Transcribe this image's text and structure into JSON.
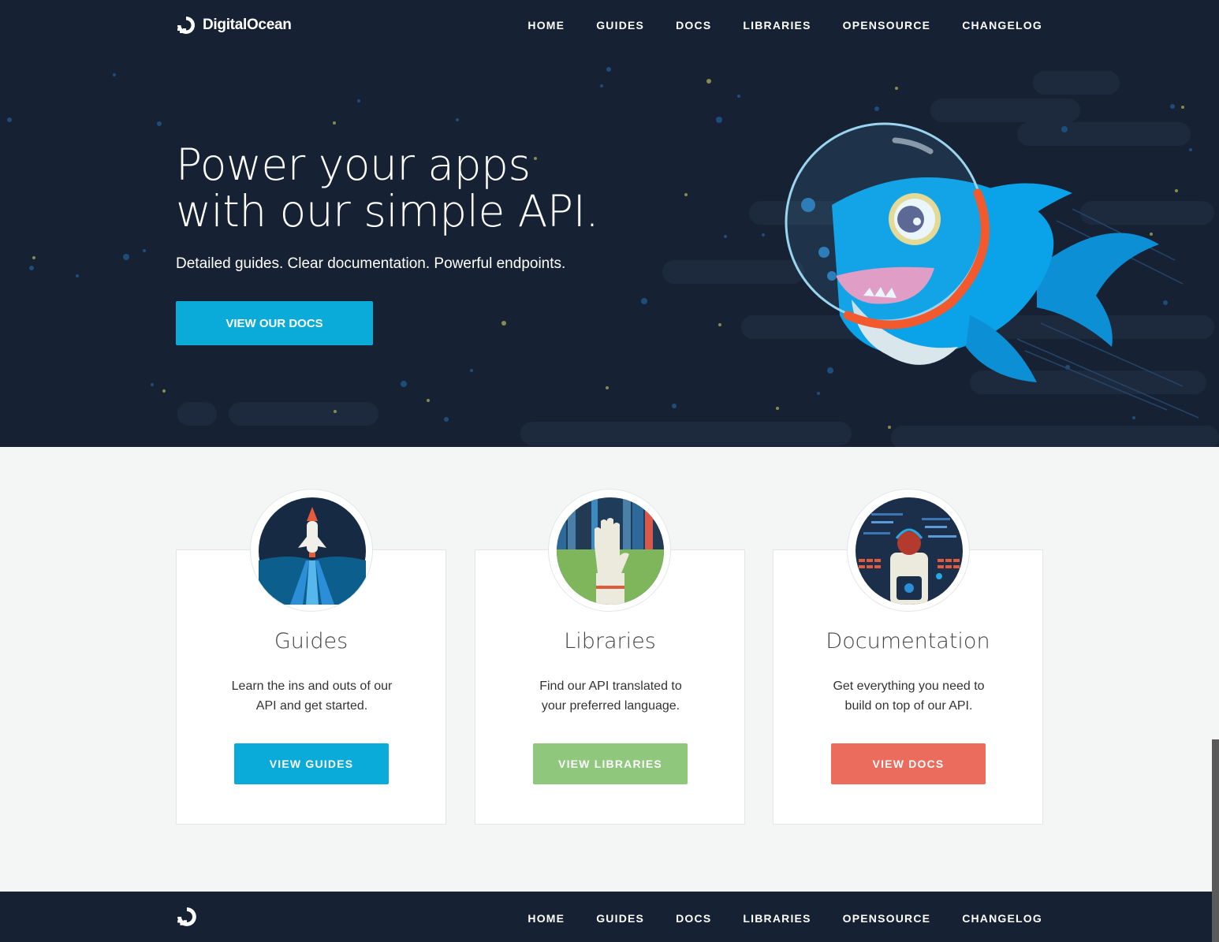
{
  "brand": {
    "name": "DigitalOcean"
  },
  "nav": {
    "items": [
      "HOME",
      "GUIDES",
      "DOCS",
      "LIBRARIES",
      "OPENSOURCE",
      "CHANGELOG"
    ]
  },
  "hero": {
    "title_line1": "Power your apps",
    "title_line2": "with our simple API.",
    "subtitle": "Detailed guides. Clear documentation. Powerful endpoints.",
    "button": "VIEW OUR DOCS"
  },
  "cards": [
    {
      "title": "Guides",
      "desc_line1": "Learn the ins and outs of our",
      "desc_line2": "API and get started.",
      "button": "VIEW GUIDES",
      "color": "#0aaad9",
      "icon": "rocket-icon"
    },
    {
      "title": "Libraries",
      "desc_line1": "Find our API translated to",
      "desc_line2": "your preferred language.",
      "button": "VIEW LIBRARIES",
      "color": "#8fc87d",
      "icon": "glove-hand-icon"
    },
    {
      "title": "Documentation",
      "desc_line1": "Get everything you need to",
      "desc_line2": "build on top of our API.",
      "button": "VIEW DOCS",
      "color": "#eb6b5d",
      "icon": "astronaut-console-icon"
    }
  ],
  "footer": {
    "nav": [
      "HOME",
      "GUIDES",
      "DOCS",
      "LIBRARIES",
      "OPENSOURCE",
      "CHANGELOG"
    ]
  },
  "colors": {
    "navy": "#162234",
    "blue": "#0aaad9",
    "green": "#8fc87d",
    "coral": "#eb6b5d"
  }
}
